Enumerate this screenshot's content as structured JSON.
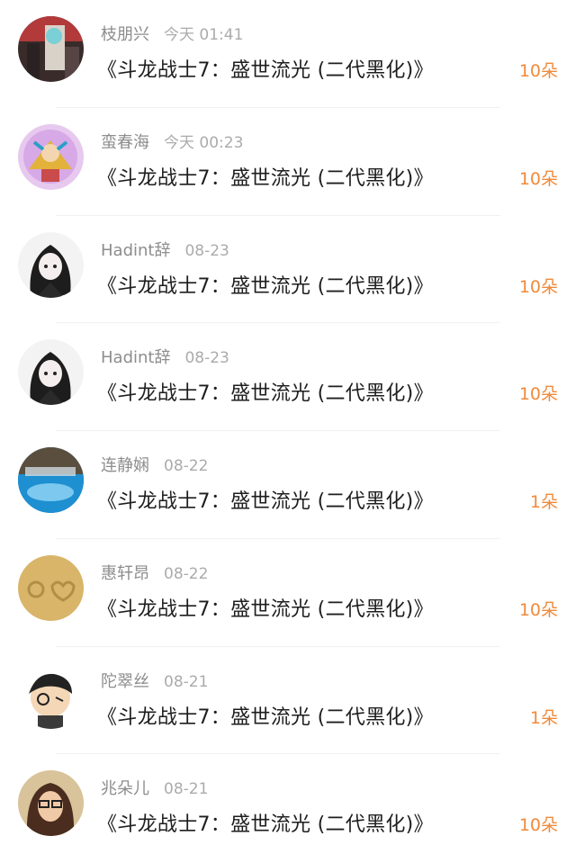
{
  "gift_list": {
    "items": [
      {
        "user": "枝朋兴",
        "time": "今天 01:41",
        "gift": "《斗龙战士7：盛世流光 (二代黑化)》",
        "count": "10朵",
        "avatar_icon": "avatar-photo-user"
      },
      {
        "user": "蛮春海",
        "time": "今天 00:23",
        "gift": "《斗龙战士7：盛世流光 (二代黑化)》",
        "count": "10朵",
        "avatar_icon": "avatar-dragon-character"
      },
      {
        "user": "Hadint辞",
        "time": "08-23",
        "gift": "《斗龙战士7：盛世流光 (二代黑化)》",
        "count": "10朵",
        "avatar_icon": "avatar-anime-girl"
      },
      {
        "user": "Hadint辞",
        "time": "08-23",
        "gift": "《斗龙战士7：盛世流光 (二代黑化)》",
        "count": "10朵",
        "avatar_icon": "avatar-anime-girl"
      },
      {
        "user": "连静娴",
        "time": "08-22",
        "gift": "《斗龙战士7：盛世流光 (二代黑化)》",
        "count": "1朵",
        "avatar_icon": "avatar-sea-scene"
      },
      {
        "user": "惠轩昂",
        "time": "08-22",
        "gift": "《斗龙战士7：盛世流光 (二代黑化)》",
        "count": "10朵",
        "avatar_icon": "avatar-sand-love"
      },
      {
        "user": "陀翠丝",
        "time": "08-21",
        "gift": "《斗龙战士7：盛世流光 (二代黑化)》",
        "count": "1朵",
        "avatar_icon": "avatar-cartoon-boy"
      },
      {
        "user": "兆朵儿",
        "time": "08-21",
        "gift": "《斗龙战士7：盛世流光 (二代黑化)》",
        "count": "10朵",
        "avatar_icon": "avatar-photo-girl"
      }
    ]
  },
  "colors": {
    "count_accent": "#f08a3a",
    "username": "#8d8d8d",
    "timestamp": "#ababab",
    "title_text": "#1e1e1e"
  }
}
